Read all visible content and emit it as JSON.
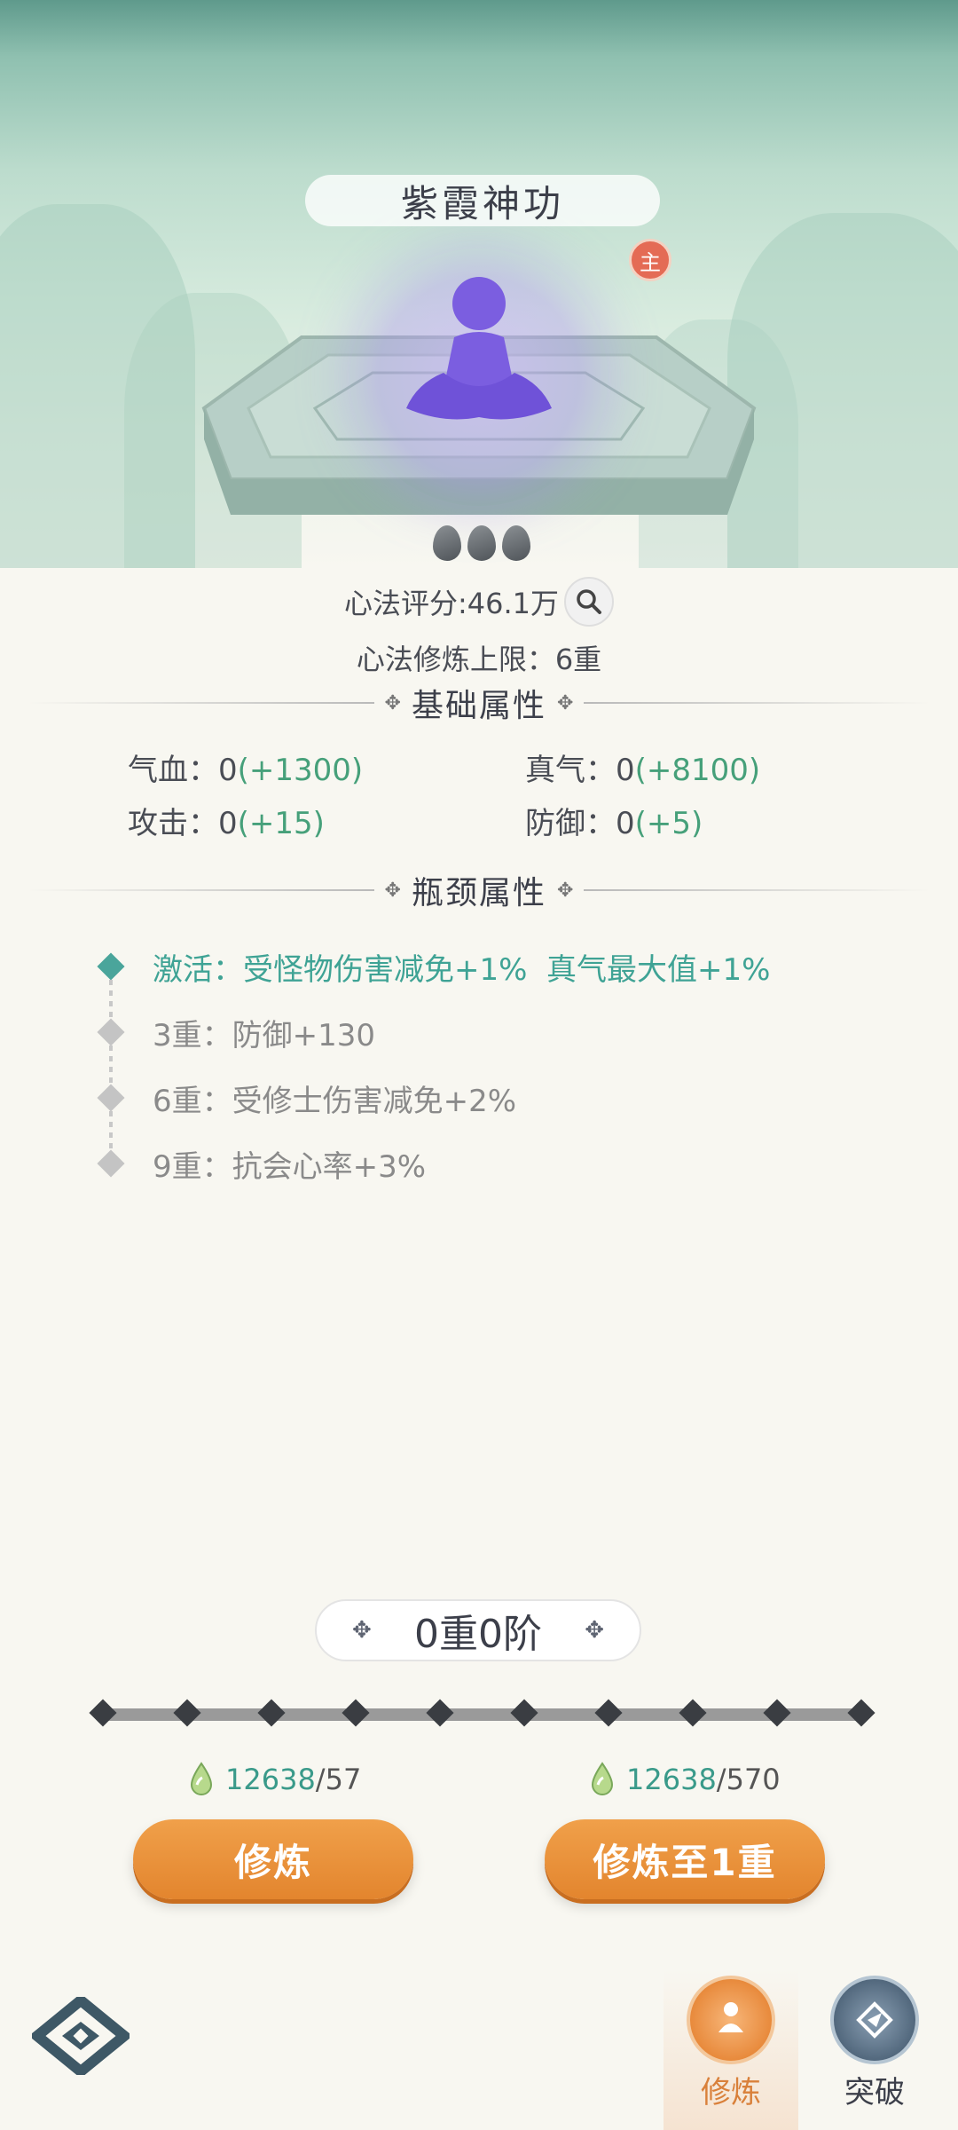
{
  "header": {
    "title": "紫霞神功",
    "master_badge": "主"
  },
  "score": {
    "label": "心法评分:46.1万"
  },
  "limit": {
    "label": "心法修炼上限：6重"
  },
  "basic_section": {
    "title": "基础属性"
  },
  "basic_attrs": [
    {
      "name": "气血：",
      "value": "0",
      "bonus": "(+1300)"
    },
    {
      "name": "真气：",
      "value": "0",
      "bonus": "(+8100)"
    },
    {
      "name": "攻击：",
      "value": "0",
      "bonus": "(+15)"
    },
    {
      "name": "防御：",
      "value": "0",
      "bonus": "(+5)"
    }
  ],
  "bottleneck_section": {
    "title": "瓶颈属性"
  },
  "bottleneck_items": [
    {
      "text": "激活：受怪物伤害减免+1%  真气最大值+1%",
      "active": true
    },
    {
      "text": "3重：防御+130",
      "active": false
    },
    {
      "text": "6重：受修士伤害减免+2%",
      "active": false
    },
    {
      "text": "9重：抗会心率+3%",
      "active": false
    }
  ],
  "level": {
    "label": "0重0阶"
  },
  "costs": [
    {
      "have": "12638",
      "need": "/57"
    },
    {
      "have": "12638",
      "need": "/570"
    }
  ],
  "buttons": {
    "cultivate": "修炼",
    "cultivate_to": "修炼至1重"
  },
  "nav": [
    {
      "label": "修炼",
      "active": true
    },
    {
      "label": "突破",
      "active": false
    }
  ],
  "colors": {
    "accent_green": "#46a07a",
    "teal": "#3fa395",
    "orange": "#e8902f",
    "nav_active": "#d9803a"
  }
}
